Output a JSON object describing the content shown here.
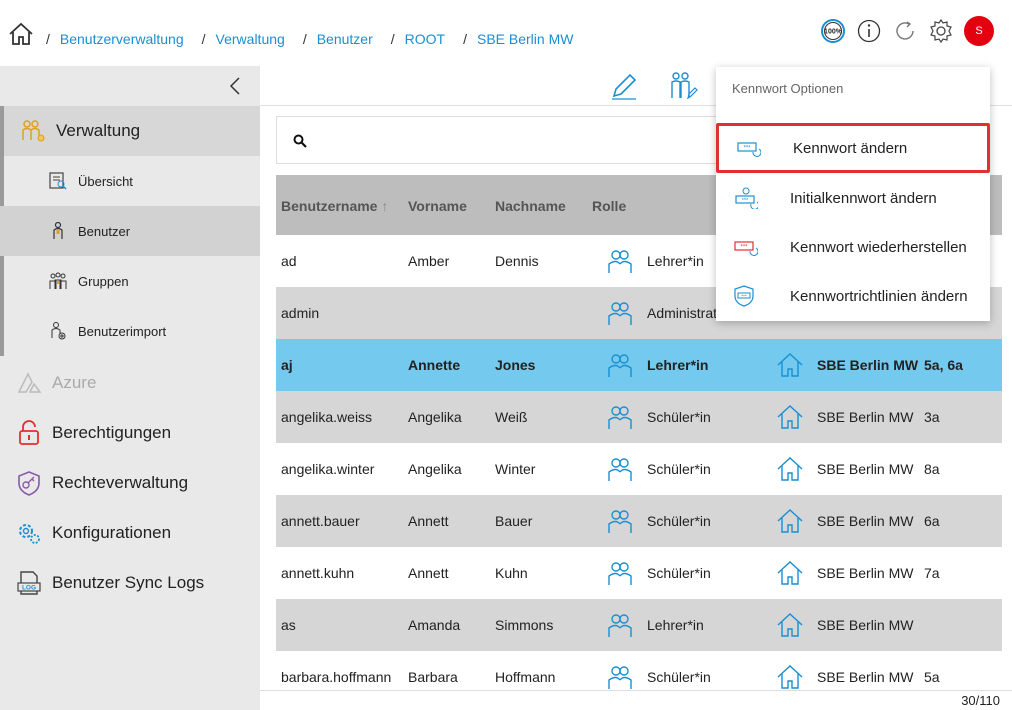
{
  "breadcrumb": [
    "Benutzerverwaltung",
    "Verwaltung",
    "Benutzer",
    "ROOT",
    "SBE Berlin MW"
  ],
  "top_icons": {
    "zoom": "100%",
    "avatar_initial": "S",
    "icons": [
      "info-icon",
      "refresh-icon",
      "gear-icon"
    ]
  },
  "sidebar": {
    "main": [
      {
        "label": "Verwaltung",
        "icon": "users-gold-icon"
      },
      {
        "label": "Azure",
        "icon": "azure-icon"
      },
      {
        "label": "Berechtigungen",
        "icon": "lock-icon"
      },
      {
        "label": "Rechteverwaltung",
        "icon": "shield-key-icon"
      },
      {
        "label": "Konfigurationen",
        "icon": "gears-icon"
      },
      {
        "label": "Benutzer Sync Logs",
        "icon": "log-icon"
      }
    ],
    "sub": [
      {
        "label": "Übersicht"
      },
      {
        "label": "Benutzer"
      },
      {
        "label": "Gruppen"
      },
      {
        "label": "Benutzerimport"
      }
    ]
  },
  "table": {
    "headers": [
      "Benutzername",
      "Vorname",
      "Nachname",
      "Rolle"
    ],
    "rows": [
      {
        "user": "ad",
        "first": "Amber",
        "last": "Dennis",
        "role": "Lehrer*in",
        "org": "",
        "classes": ""
      },
      {
        "user": "admin",
        "first": "",
        "last": "",
        "role": "Administrat",
        "org": "",
        "classes": ""
      },
      {
        "user": "aj",
        "first": "Annette",
        "last": "Jones",
        "role": "Lehrer*in",
        "org": "SBE Berlin MW",
        "classes": "5a, 6a"
      },
      {
        "user": "angelika.weiss",
        "first": "Angelika",
        "last": "Weiß",
        "role": "Schüler*in",
        "org": "SBE Berlin MW",
        "classes": "3a"
      },
      {
        "user": "angelika.winter",
        "first": "Angelika",
        "last": "Winter",
        "role": "Schüler*in",
        "org": "SBE Berlin MW",
        "classes": "8a"
      },
      {
        "user": "annett.bauer",
        "first": "Annett",
        "last": "Bauer",
        "role": "Schüler*in",
        "org": "SBE Berlin MW",
        "classes": "6a"
      },
      {
        "user": "annett.kuhn",
        "first": "Annett",
        "last": "Kuhn",
        "role": "Schüler*in",
        "org": "SBE Berlin MW",
        "classes": "7a"
      },
      {
        "user": "as",
        "first": "Amanda",
        "last": "Simmons",
        "role": "Lehrer*in",
        "org": "SBE Berlin MW",
        "classes": ""
      },
      {
        "user": "barbara.hoffmann",
        "first": "Barbara",
        "last": "Hoffmann",
        "role": "Schüler*in",
        "org": "SBE Berlin MW",
        "classes": "5a"
      }
    ]
  },
  "pager": "30/110",
  "menu": {
    "title": "Kennwort Optionen",
    "items": [
      {
        "label": "Kennwort ändern"
      },
      {
        "label": "Initialkennwort ändern"
      },
      {
        "label": "Kennwort wiederherstellen"
      },
      {
        "label": "Kennwortrichtlinien ändern"
      }
    ]
  },
  "colors": {
    "accent": "#1a8fd1",
    "selected_row": "#74c9ef",
    "highlight": "#e03030",
    "avatar": "#e3000f"
  }
}
